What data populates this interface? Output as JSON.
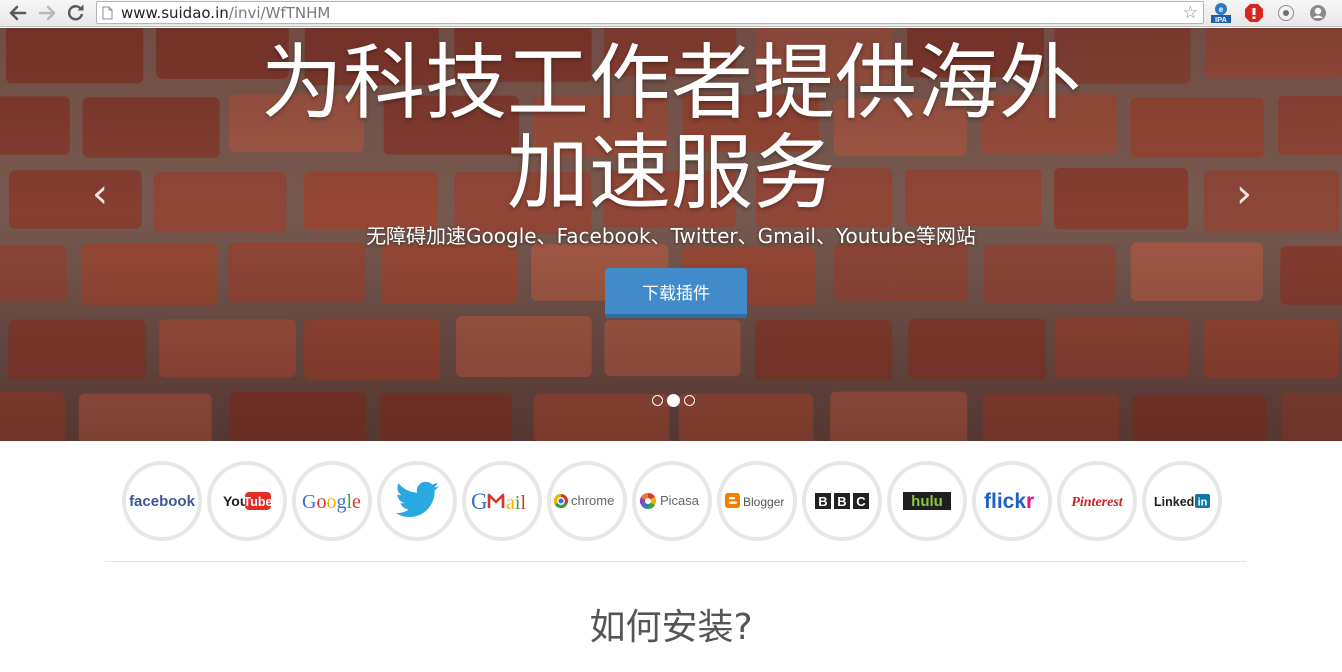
{
  "browser": {
    "url_host": "www.suidao.in",
    "url_path": "/invi/WfTNHM",
    "star_glyph": "☆",
    "ipa_badge": "IPA"
  },
  "hero": {
    "title_line1": "为科技工作者提供海外",
    "title_line2": "加速服务",
    "subtitle": "无障碍加速Google、Facebook、Twitter、Gmail、Youtube等网站",
    "cta_label": "下载插件",
    "prev_glyph": "‹",
    "next_glyph": "›",
    "slide_count": 3,
    "active_slide": 2,
    "accent_color": "#428bca"
  },
  "logos": [
    {
      "name": "facebook"
    },
    {
      "name": "youtube",
      "you": "You",
      "tube": "Tube"
    },
    {
      "name": "google",
      "letters": [
        "G",
        "o",
        "o",
        "g",
        "l",
        "e"
      ]
    },
    {
      "name": "twitter"
    },
    {
      "name": "gmail",
      "letters": [
        "G",
        "m",
        "a",
        "i",
        "l"
      ]
    },
    {
      "name": "chrome",
      "text": "chrome"
    },
    {
      "name": "picasa",
      "text": "Picasa"
    },
    {
      "name": "blogger",
      "text": "Blogger"
    },
    {
      "name": "bbc",
      "letters": [
        "B",
        "B",
        "C"
      ]
    },
    {
      "name": "hulu",
      "text": "hulu"
    },
    {
      "name": "flickr",
      "flick": "flick",
      "r": "r"
    },
    {
      "name": "pinterest",
      "text": "Pinterest"
    },
    {
      "name": "linkedin",
      "linked": "Linked",
      "in": "in"
    }
  ],
  "section": {
    "heading": "如何安装?"
  }
}
